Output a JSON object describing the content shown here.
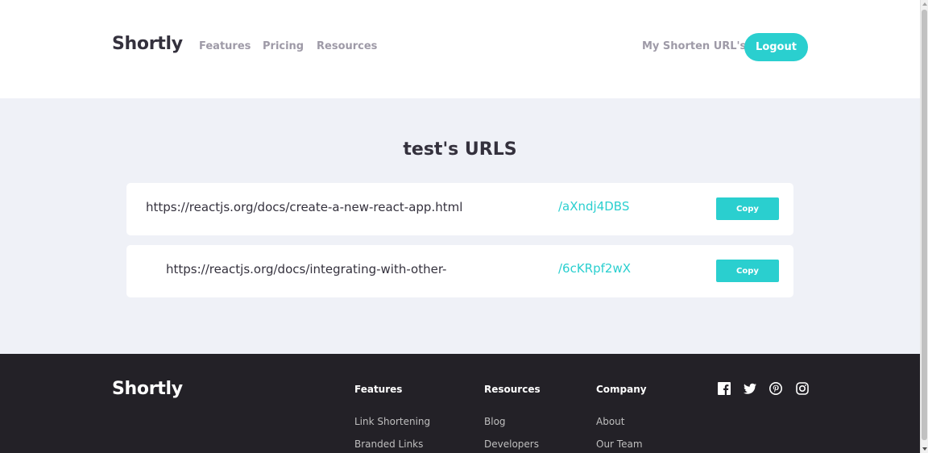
{
  "header": {
    "logo": "Shortly",
    "nav": {
      "features": "Features",
      "pricing": "Pricing",
      "resources": "Resources"
    },
    "my_urls_label": "My Shorten URL's",
    "logout_label": "Logout"
  },
  "main": {
    "title": "test's URLS",
    "urls": [
      {
        "original": "https://reactjs.org/docs/create-a-new-react-app.html",
        "short": "/aXndj4DBS",
        "copy_label": "Copy"
      },
      {
        "original": "https://reactjs.org/docs/integrating-with-other-",
        "short": "/6cKRpf2wX",
        "copy_label": "Copy"
      }
    ]
  },
  "footer": {
    "logo": "Shortly",
    "columns": [
      {
        "heading": "Features",
        "links": [
          "Link Shortening",
          "Branded Links"
        ]
      },
      {
        "heading": "Resources",
        "links": [
          "Blog",
          "Developers"
        ]
      },
      {
        "heading": "Company",
        "links": [
          "About",
          "Our Team"
        ]
      }
    ],
    "social_icons": [
      "facebook-icon",
      "twitter-icon",
      "pinterest-icon",
      "instagram-icon"
    ]
  },
  "colors": {
    "accent": "#2acfcf",
    "dark_text": "#34313d",
    "gray_text": "#9e9aa7",
    "main_bg": "#eff1f7",
    "footer_bg": "#232127"
  }
}
